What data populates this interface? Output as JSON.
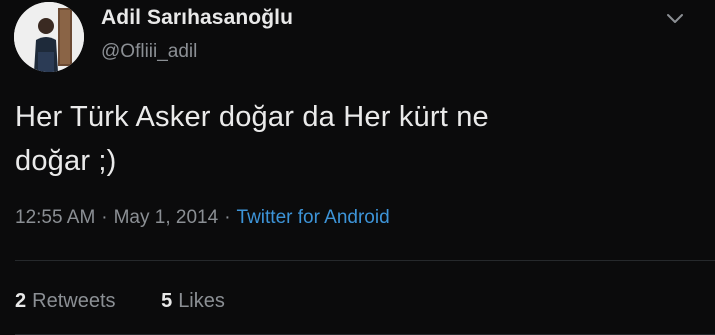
{
  "author": {
    "display_name": "Adil Sarıhasanoğlu",
    "handle": "@Ofliii_adil"
  },
  "menu_icon": "chevron-down-icon",
  "tweet": {
    "text_line1": "Her Türk Asker doğar da Her kürt ne",
    "text_line2": "doğar ;)",
    "time": "12:55 AM",
    "date": "May 1, 2014",
    "separator": "·",
    "source": "Twitter for Android"
  },
  "stats": {
    "retweets_count": "2",
    "retweets_label": "Retweets",
    "likes_count": "5",
    "likes_label": "Likes"
  },
  "colors": {
    "background": "#0b0b0c",
    "primary_text": "#e9e9e9",
    "secondary_text": "#8b8f94",
    "link": "#3d94d8"
  }
}
